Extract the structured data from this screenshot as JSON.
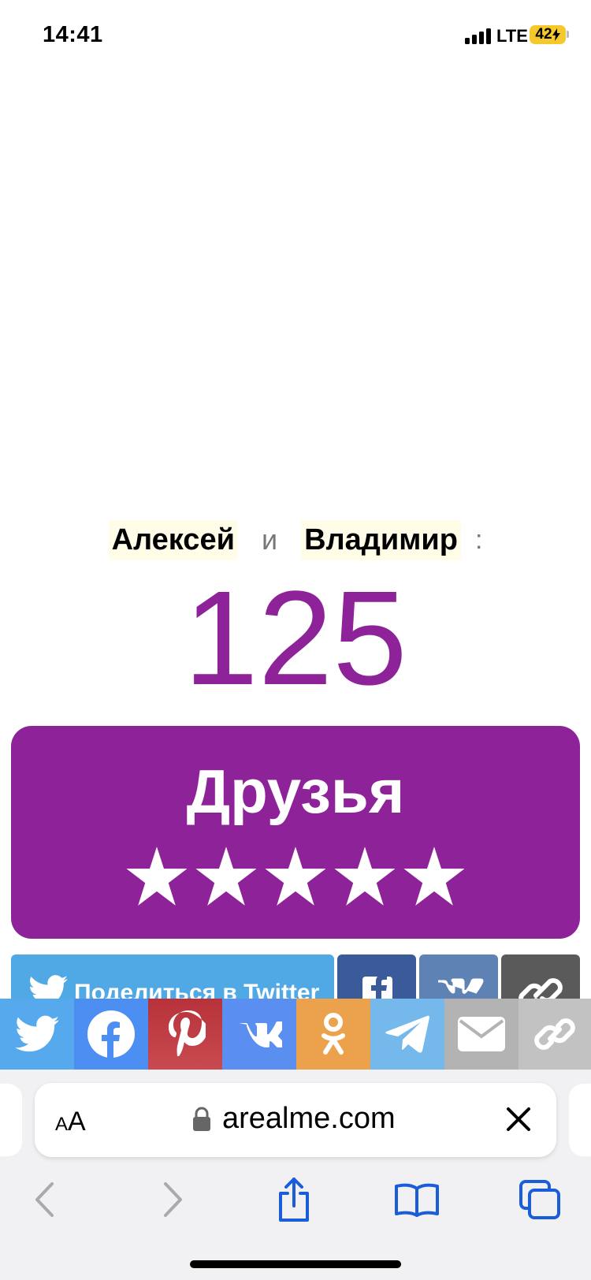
{
  "status_bar": {
    "time": "14:41",
    "network": "LTE",
    "battery": "42"
  },
  "result": {
    "name_one": "Алексей",
    "and_word": "и",
    "name_two": "Владимир",
    "colon": ":",
    "score": "125",
    "title": "Друзья",
    "stars_rating": 5
  },
  "share_row": {
    "twitter_label": "Поделиться в Twitter"
  },
  "share_bar": {
    "items": [
      "twitter-icon",
      "facebook-icon",
      "pinterest-icon",
      "vk-icon",
      "odnoklassniki-icon",
      "telegram-icon",
      "mail-icon",
      "link-icon"
    ]
  },
  "browser": {
    "text_size_label_small": "A",
    "text_size_label_large": "A",
    "domain": "arealme.com"
  },
  "colors": {
    "accent": "#8e2399",
    "twitter": "#56a9ec",
    "facebook": "#4c8ef2",
    "pinterest": "#b8323a",
    "vk": "#5a8ef0",
    "ok": "#eca24d",
    "telegram": "#74b8ec",
    "safari_blue": "#1a5ddb"
  }
}
